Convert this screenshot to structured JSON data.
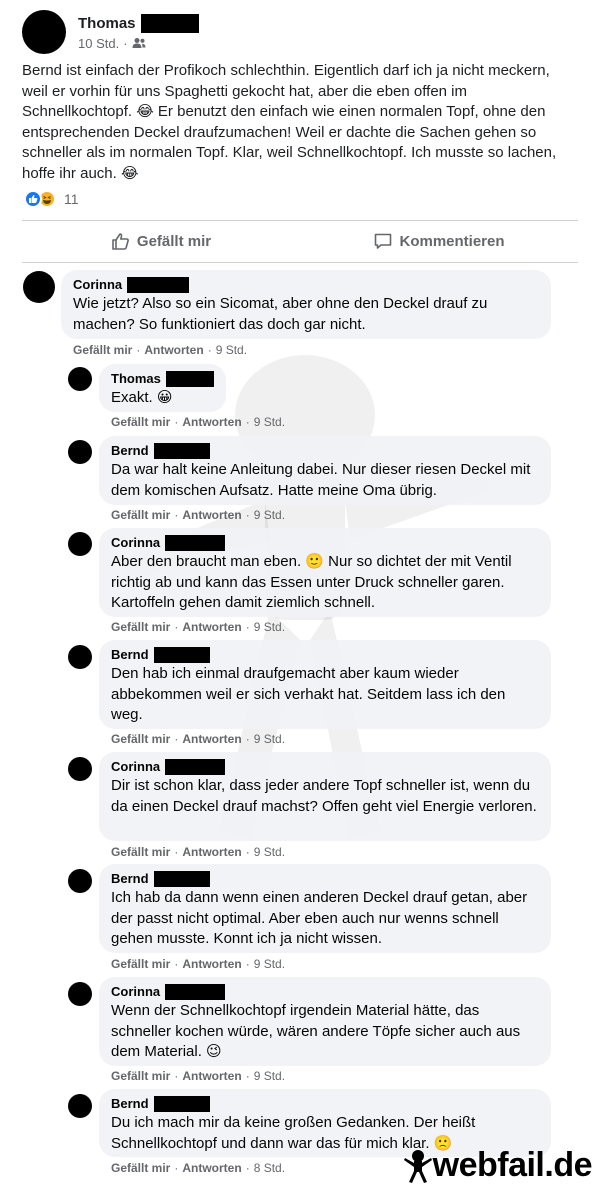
{
  "post": {
    "author": "Thomas",
    "time": "10 Std.",
    "audience_icon": "friends-icon",
    "text": "Bernd ist einfach der Profikoch schlechthin. Eigentlich darf ich ja nicht meckern, weil er vorhin für uns Spaghetti gekocht hat, aber die eben offen im Schnellkochtopf. 😂 Er benutzt den einfach wie einen normalen Topf, ohne den entsprechenden Deckel draufzumachen! Weil er dachte die Sachen gehen so schneller als im normalen Topf. Klar, weil Schnellkochtopf. Ich musste so lachen, hoffe ihr auch. 😂",
    "reaction_count": "11",
    "reactions": [
      "like-icon",
      "haha-icon"
    ]
  },
  "actions": {
    "like_label": "Gefällt mir",
    "comment_label": "Kommentieren"
  },
  "comment_actions": {
    "like": "Gefällt mir",
    "reply": "Antworten"
  },
  "comments": [
    {
      "author": "Corinna",
      "text": "Wie jetzt? Also so ein Sicomat, aber ohne den Deckel drauf zu machen? So funktioniert das doch gar nicht.",
      "time": "9 Std."
    },
    {
      "author": "Thomas",
      "text": "Exakt. 😀",
      "time": "9 Std."
    },
    {
      "author": "Bernd",
      "text": "Da war halt keine Anleitung dabei. Nur dieser riesen Deckel mit dem komischen Aufsatz. Hatte meine Oma übrig.",
      "time": "9 Std."
    },
    {
      "author": "Corinna",
      "text": "Aber den braucht man eben. 🙂 Nur so dichtet der mit Ventil richtig ab und kann das Essen unter Druck schneller garen. Kartoffeln gehen damit ziemlich schnell.",
      "time": "9 Std."
    },
    {
      "author": "Bernd",
      "text": "Den hab ich einmal draufgemacht aber kaum wieder abbekommen weil er sich verhakt hat. Seitdem lass ich den weg.",
      "time": "9 Std."
    },
    {
      "author": "Corinna",
      "text": "Dir ist schon klar, dass jeder andere Topf schneller ist, wenn du da einen Deckel drauf machst? Offen geht viel Energie verloren.",
      "time": "9 Std."
    },
    {
      "author": "Bernd",
      "text": "Ich hab da dann wenn einen anderen Deckel drauf getan, aber der passt nicht optimal. Aber eben auch nur wenns schnell gehen musste. Konnt ich ja nicht wissen.",
      "time": "9 Std."
    },
    {
      "author": "Corinna",
      "text": "Wenn der Schnellkochtopf irgendein Material hätte, das schneller kochen würde, wären andere Töpfe sicher auch aus dem Material. 😉",
      "time": "9 Std."
    },
    {
      "author": "Bernd",
      "text": "Du ich mach mir da keine großen Gedanken. Der heißt Schnellkochtopf und dann war das für mich klar. 🙁",
      "time": "8 Std."
    }
  ],
  "watermark": {
    "text": "webfail.de"
  }
}
